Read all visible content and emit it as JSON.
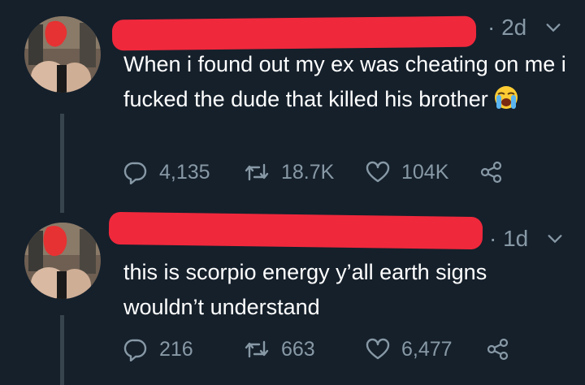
{
  "tweets": [
    {
      "time": "2d",
      "text": "When i found out my ex was cheating on me i fucked the dude that killed his brother",
      "emoji": "loudly-crying-face",
      "replies": "4,135",
      "retweets": "18.7K",
      "likes": "104K"
    },
    {
      "time": "1d",
      "text": "this is scorpio energy y’all earth signs wouldn’t understand",
      "replies": "216",
      "retweets": "663",
      "likes": "6,477"
    }
  ],
  "colors": {
    "background": "#15202b",
    "muted": "#8899a6",
    "thread_line": "#38444d",
    "redaction": "#f0283c"
  },
  "icons": [
    "reply-icon",
    "retweet-icon",
    "like-icon",
    "share-icon",
    "chevron-down-icon"
  ]
}
